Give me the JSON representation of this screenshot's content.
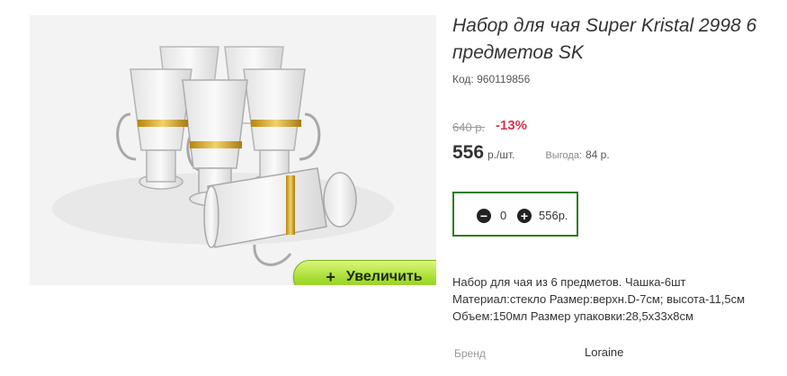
{
  "product": {
    "title": "Набор для чая Super Kristal 2998 6 предметов SK",
    "code_label": "Код:",
    "code_value": "960119856"
  },
  "gallery": {
    "zoom_label": "Увеличить",
    "zoom_icon": "+"
  },
  "price": {
    "old": "640 р.",
    "discount": "-13%",
    "current": "556",
    "unit": "р./шт.",
    "benefit_label": "Выгода:",
    "benefit_value": "84 р."
  },
  "quantity": {
    "value": "0",
    "total": "556р.",
    "minus_icon": "minus-circle-icon",
    "plus_icon": "plus-circle-icon"
  },
  "description": {
    "line1": "Набор для чая из 6 предметов. Чашка-6шт",
    "line2": "Материал:стекло Размер:верхн.D-7см; высота-11,5см",
    "line3": "Объем:150мл Размер упаковки:28,5х33х8см"
  },
  "specs": {
    "brand_label": "Бренд",
    "brand_value": "Loraine"
  },
  "colors": {
    "accent_green": "#2a7e1a",
    "discount_red": "#d8344c",
    "zoom_button": "#a6dc33"
  }
}
